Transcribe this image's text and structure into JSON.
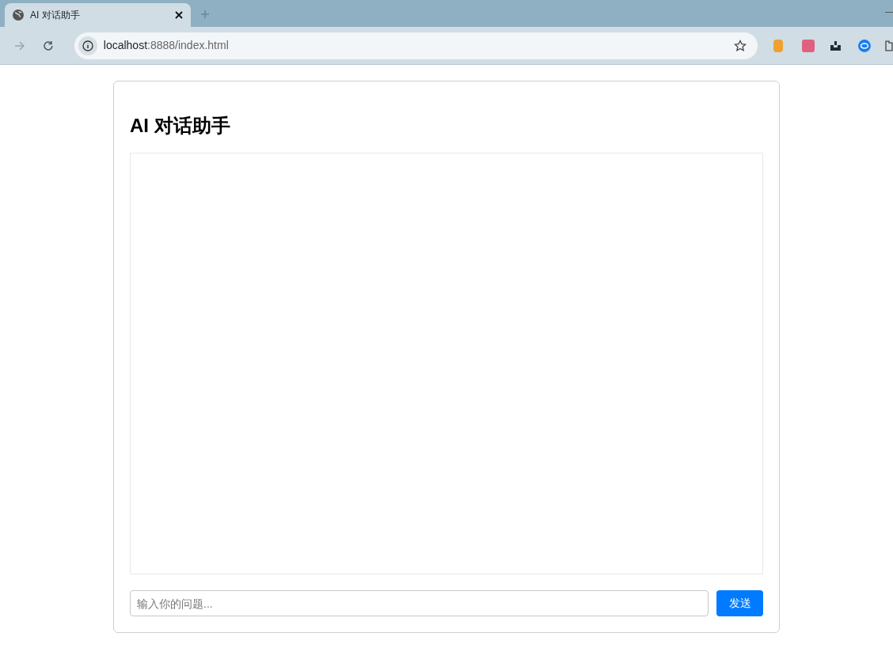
{
  "browser": {
    "tab": {
      "title": "AI 对话助手"
    },
    "address": {
      "host": "localhost",
      "path": ":8888/index.html"
    }
  },
  "page": {
    "title": "AI 对话助手",
    "input": {
      "placeholder": "输入你的问题..."
    },
    "send_button": "发送"
  }
}
